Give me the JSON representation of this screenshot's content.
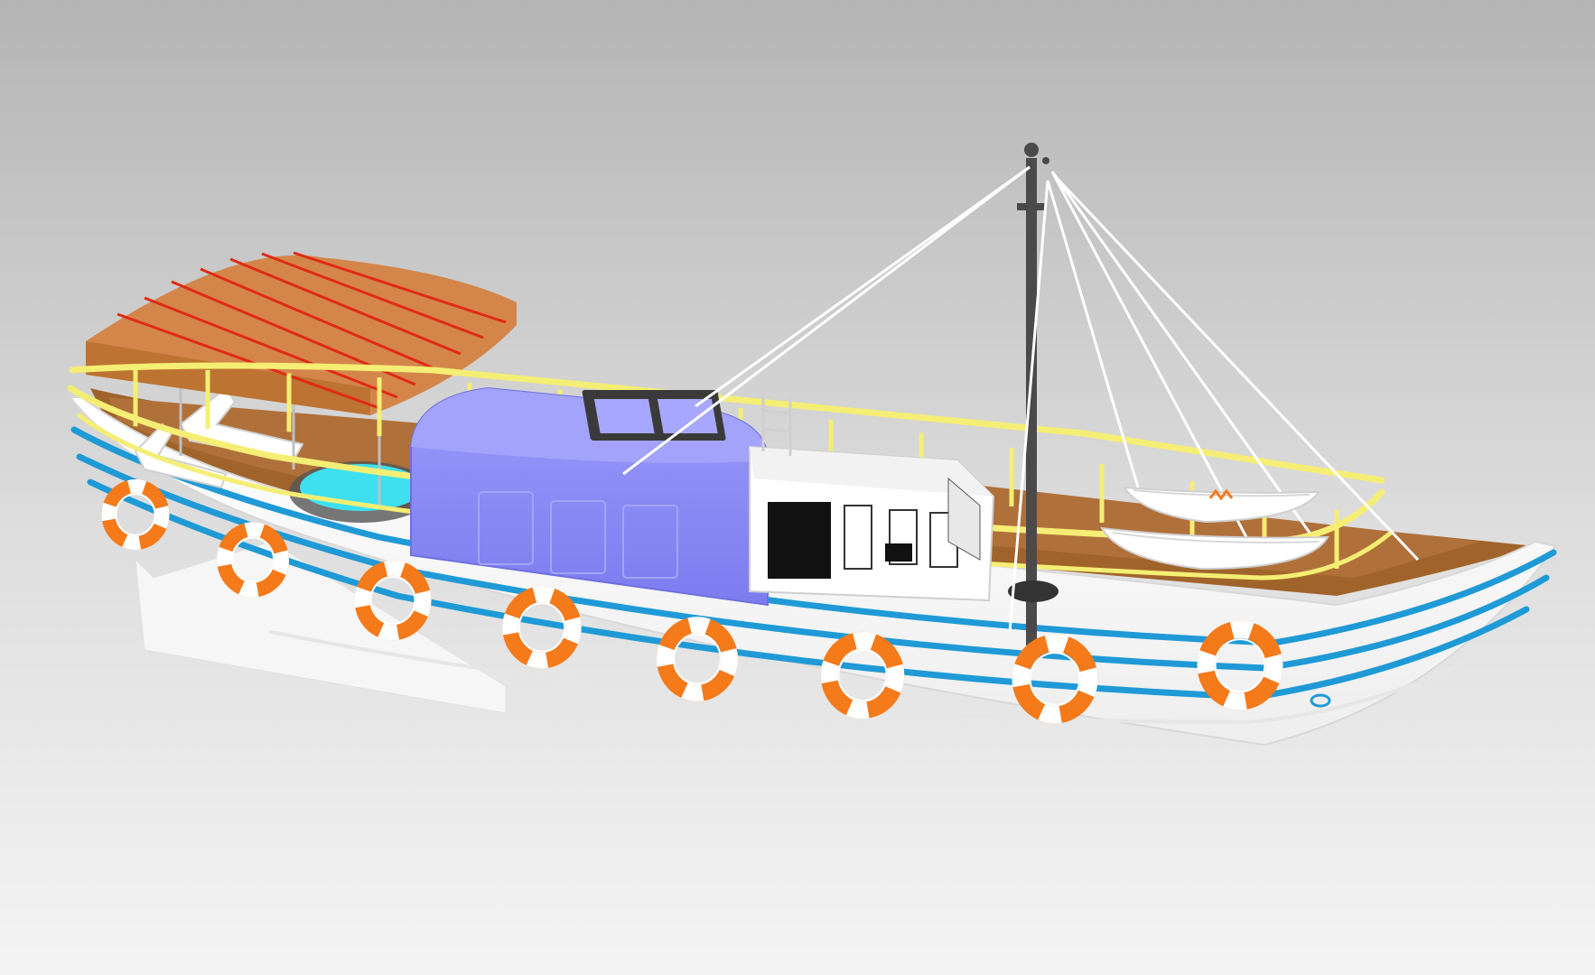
{
  "scene": {
    "subject": "boat-3d-render",
    "colors": {
      "background_top": "#b4b4b4",
      "background_bottom": "#f4f4f4",
      "hull": "#ffffff",
      "hull_stripe": "#1f9ad6",
      "railing": "#f5ee74",
      "deck": "#a0642a",
      "canopy": "#d4864a",
      "canopy_stripe": "#e02a16",
      "cabin": "#8c8cf6",
      "wheelhouse": "#ffffff",
      "mast": "#4a4a4a",
      "rigging": "#ffffff",
      "pool_water": "#3ee0f0",
      "lifebuoy_orange": "#f57a1a",
      "lifebuoy_white": "#ffffff"
    },
    "lifebuoy_count": 8,
    "dinghy_count": 2,
    "icons": [
      "lifebuoy-icon",
      "mast-icon",
      "canopy-icon"
    ]
  }
}
